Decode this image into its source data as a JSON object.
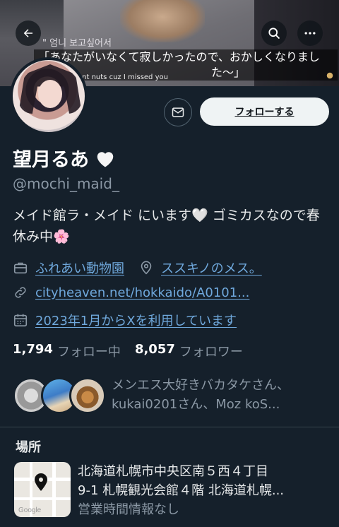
{
  "banner": {
    "subtitle_ko": "\" 엄니 보고싶어서",
    "subtitle_jp_line1": "「あなたがいなくて寂しかったので、おかしくなりまし",
    "subtitle_jp_line2": "た〜」",
    "subtitle_en": "ent nuts cuz I missed you"
  },
  "profile": {
    "display_name": "望月るあ",
    "handle": "@mochi_maid_",
    "bio": "メイド館ラ・メイド にいます🤍 ゴミカスなので春休み中🌸",
    "follow_label": "フォローする",
    "category": "ふれあい動物園",
    "location": "ススキノのメス。",
    "website": "cityheaven.net/hokkaido/A0101...",
    "joined": "2023年1月からXを利用しています",
    "following_count": "1,794",
    "following_label": "フォロー中",
    "followers_count": "8,057",
    "followers_label": "フォロワー",
    "followed_by_line1": "メンエス大好きバカタケさん、",
    "followed_by_line2": "kukai0201さん、Moz koS..."
  },
  "location_card": {
    "title": "場所",
    "address_line1": "北海道札幌市中央区南５西４丁目",
    "address_line2": "9-1 札幌観光会館４階 北海道札幌...",
    "hours": "営業時間情報なし",
    "map_label": "Google"
  },
  "icons": [
    "back-arrow-icon",
    "search-icon",
    "more-icon",
    "message-icon",
    "briefcase-icon",
    "location-pin-icon",
    "link-icon",
    "calendar-icon",
    "white-heart-icon",
    "map-pin-icon"
  ],
  "colors": {
    "background": "#15202b",
    "link": "#6fa8dc",
    "muted": "#8b98a5",
    "follow_button": "#eff3f4"
  }
}
